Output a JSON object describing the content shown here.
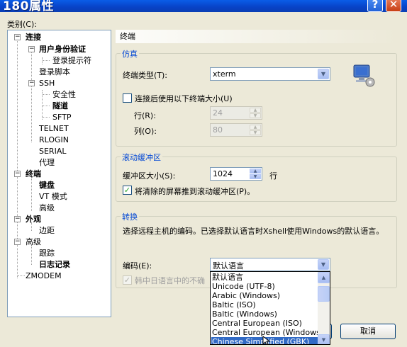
{
  "window": {
    "title": "180属性",
    "help_glyph": "?",
    "close_glyph": "✕"
  },
  "sidebar": {
    "label": "类别(C):",
    "items": [
      {
        "label": "连接",
        "bold": true,
        "expander": "−"
      },
      {
        "label": "用户身份验证",
        "bold": true,
        "expander": "−"
      },
      {
        "label": "登录提示符",
        "bold": false
      },
      {
        "label": "登录脚本",
        "bold": false
      },
      {
        "label": "SSH",
        "bold": false,
        "expander": "−"
      },
      {
        "label": "安全性",
        "bold": false
      },
      {
        "label": "隧道",
        "bold": true
      },
      {
        "label": "SFTP",
        "bold": false
      },
      {
        "label": "TELNET",
        "bold": false
      },
      {
        "label": "RLOGIN",
        "bold": false
      },
      {
        "label": "SERIAL",
        "bold": false
      },
      {
        "label": "代理",
        "bold": false
      },
      {
        "label": "终端",
        "bold": true,
        "expander": "−"
      },
      {
        "label": "键盘",
        "bold": true
      },
      {
        "label": "VT 模式",
        "bold": false
      },
      {
        "label": "高级",
        "bold": false
      },
      {
        "label": "外观",
        "bold": true,
        "expander": "−"
      },
      {
        "label": "边距",
        "bold": false
      },
      {
        "label": "高级",
        "bold": false,
        "expander": "−"
      },
      {
        "label": "跟踪",
        "bold": false
      },
      {
        "label": "日志记录",
        "bold": true
      },
      {
        "label": "ZMODEM",
        "bold": false
      }
    ]
  },
  "main": {
    "header": "终端",
    "emulation": {
      "title": "仿真",
      "terminal_type_label": "终端类型(T):",
      "terminal_type_value": "xterm",
      "resize_checkbox_label": "连接后使用以下终端大小(U)",
      "resize_checked": false,
      "rows_label": "行(R):",
      "rows_value": "24",
      "cols_label": "列(O):",
      "cols_value": "80"
    },
    "scrollback": {
      "title": "滚动缓冲区",
      "size_label": "缓冲区大小(S):",
      "size_value": "1024",
      "size_unit": "行",
      "push_checkbox_label": "将清除的屏幕推到滚动缓冲区(P)。",
      "push_checked": true
    },
    "translation": {
      "title": "转换",
      "description": "选择远程主机的编码。已选择默认语言时Xshell使用Windows的默认语言。",
      "encoding_label": "编码(E):",
      "encoding_value": "默认语言",
      "japanese_checkbox_label": "韩中日语言中的不确",
      "japanese_checked": true,
      "options": [
        "默认语言",
        "Unicode (UTF-8)",
        "Arabic (Windows)",
        "Baltic (ISO)",
        "Baltic (Windows)",
        "Central European (ISO)",
        "Central European (Windows)",
        "Chinese Simplified (GBK)"
      ],
      "selected_index": 7
    }
  },
  "buttons": {
    "cancel_label": "取消"
  },
  "icons": {
    "checkmark": "✓",
    "combo_arrow": "▼",
    "spin_up": "▲",
    "spin_down": "▼"
  }
}
